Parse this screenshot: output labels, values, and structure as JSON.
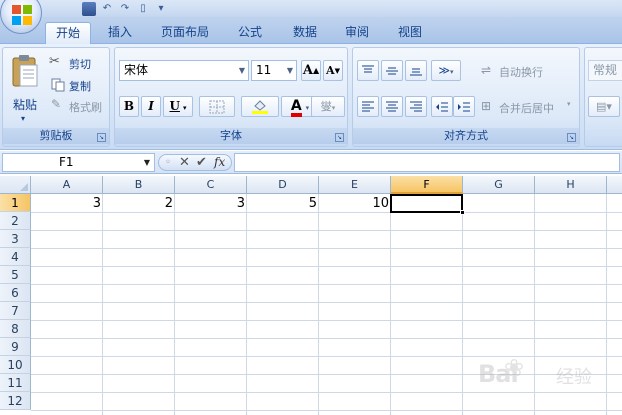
{
  "tabs": [
    "开始",
    "插入",
    "页面布局",
    "公式",
    "数据",
    "审阅",
    "视图"
  ],
  "active_tab": "开始",
  "clipboard": {
    "paste_label": "粘贴",
    "cut_label": "剪切",
    "copy_label": "复制",
    "format_painter_label": "格式刷",
    "group_label": "剪贴板"
  },
  "font": {
    "font_name": "宋体",
    "font_size": "11",
    "bold": "B",
    "italic": "I",
    "underline": "U",
    "grow_font": "A",
    "shrink_font": "A",
    "font_color_glyph": "A",
    "phonetic_glyph": "燮",
    "group_label": "字体"
  },
  "alignment": {
    "wrap_text_label": "自动换行",
    "merge_center_label": "合并后居中",
    "group_label": "对齐方式"
  },
  "number": {
    "format_value": "常规"
  },
  "formula_bar": {
    "name_box": "F1",
    "cancel": "✕",
    "enter": "✔",
    "fx": "fx",
    "content": ""
  },
  "sheet": {
    "columns": [
      "A",
      "B",
      "C",
      "D",
      "E",
      "F",
      "G",
      "H"
    ],
    "rows": [
      "1",
      "2",
      "3",
      "4",
      "5",
      "6",
      "7",
      "8",
      "9",
      "10",
      "11",
      "12"
    ],
    "selected_cell": "F1",
    "cells": {
      "A1": "3",
      "B1": "2",
      "C1": "3",
      "D1": "5",
      "E1": "10"
    }
  },
  "watermark": {
    "brand": "Bai",
    "suffix": "经验"
  },
  "colors": {
    "ribbon_bg": "#d7e5f7",
    "accent": "#15428b",
    "selected_header": "#f6c565",
    "font_color_bar": "#e00000",
    "fill_color_bar": "#ffff00"
  }
}
